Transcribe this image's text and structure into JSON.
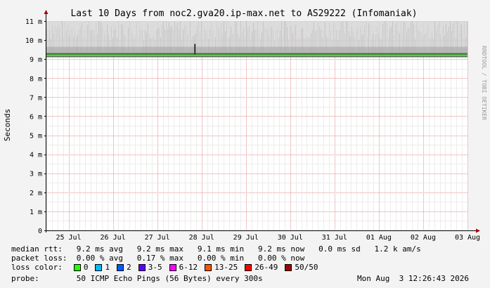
{
  "chart_data": {
    "type": "line",
    "title": "Last 10 Days from noc2.gva20.ip-max.net to AS29222 (Infomaniak)",
    "ylabel": "Seconds",
    "watermark": "RRDTOOL / TOBI OETIKER",
    "y_ticks": [
      "0",
      "1 m",
      "2 m",
      "3 m",
      "4 m",
      "5 m",
      "6 m",
      "7 m",
      "8 m",
      "9 m",
      "10 m",
      "11 m"
    ],
    "ylim_ms": [
      0,
      11
    ],
    "x_ticks": [
      "25 Jul",
      "26 Jul",
      "27 Jul",
      "28 Jul",
      "29 Jul",
      "30 Jul",
      "31 Jul",
      "01 Aug",
      "02 Aug",
      "03 Aug"
    ],
    "xlim_days": [
      24.5,
      34.0
    ],
    "series": [
      {
        "name": "median rtt",
        "values_ms": [
          9.2,
          9.2,
          9.2,
          9.2,
          9.2,
          9.2,
          9.2,
          9.2,
          9.2,
          9.2,
          9.2
        ],
        "x_days": [
          24.5,
          25.5,
          26.5,
          27.5,
          28.5,
          29.5,
          30.5,
          31.5,
          32.5,
          33.5,
          34.0
        ]
      }
    ],
    "smoke_upper_ms": 11.0,
    "grid": true
  },
  "stats": {
    "median_rtt": "median rtt:   9.2 ms avg   9.2 ms max   9.1 ms min   9.2 ms now   0.0 ms sd   1.2 k am/s",
    "packet_loss": "packet loss:  0.00 % avg   0.17 % max   0.00 % min   0.00 % now",
    "loss_color_label": "loss color:",
    "probe": "probe:        50 ICMP Echo Pings (56 Bytes) every 300s",
    "timestamp": "Mon Aug  3 12:26:43 2026"
  },
  "loss_legend": [
    {
      "label": "0",
      "color": "#26ff00"
    },
    {
      "label": "1",
      "color": "#00b8ff"
    },
    {
      "label": "2",
      "color": "#0059ff"
    },
    {
      "label": "3-5",
      "color": "#5e00ff"
    },
    {
      "label": "6-12",
      "color": "#ff00ff"
    },
    {
      "label": "13-25",
      "color": "#ff5500"
    },
    {
      "label": "26-49",
      "color": "#ff0000"
    },
    {
      "label": "50/50",
      "color": "#a10000"
    }
  ],
  "colors": {
    "background": "#f3f3f3",
    "plot_bg": "#ffffff",
    "grid_major": "#f4a0a0",
    "grid_minor": "#ececec",
    "axis": "#000000",
    "arrow": "#aa0000",
    "rtt_line": "#26ff00",
    "smoke": "#9a9a9a"
  }
}
